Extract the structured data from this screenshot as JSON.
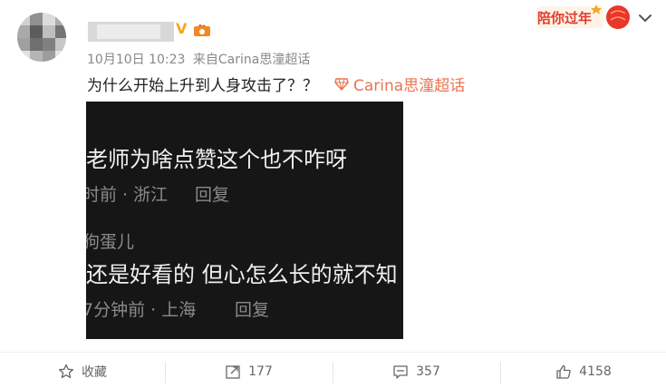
{
  "header": {
    "time": "10月10日 10:23",
    "source_prefix": "来自",
    "source": "Carina思潼超话",
    "deco_text": "陪你过年"
  },
  "post": {
    "text": "为什么开始上升到人身攻击了？？",
    "topic": "Carina思潼超话"
  },
  "image": {
    "comment1": "老师为啥点赞这个也不咋呀",
    "meta1": "时前 · 浙江",
    "reply1": "回复",
    "user2": "狗蛋儿",
    "comment2": "还是好看的   但心怎么长的就不知",
    "meta2": "7分钟前 · 上海",
    "reply2": "回复"
  },
  "actions": {
    "favorite_label": "收藏",
    "repost_count": "177",
    "comment_count": "357",
    "like_count": "4158"
  },
  "colors": {
    "topic": "#eb7350",
    "meta": "#888888",
    "image_bg": "#161616"
  },
  "icons": [
    "star-icon",
    "repost-icon",
    "comment-icon",
    "like-icon",
    "chevron-down-icon",
    "topic-icon",
    "verified-icon",
    "fire-badge-icon"
  ]
}
